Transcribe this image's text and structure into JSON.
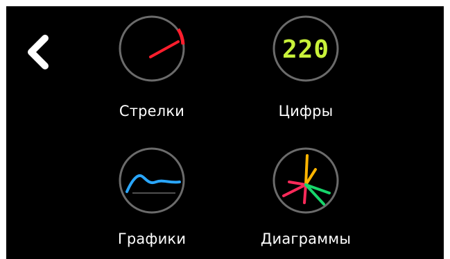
{
  "navigation": {
    "back_icon": "chevron-left-icon"
  },
  "modes": [
    {
      "label": "Стрелки",
      "icon": "needle-gauge-icon"
    },
    {
      "label": "Цифры",
      "icon": "digital-display-icon",
      "display_value": "220"
    },
    {
      "label": "Графики",
      "icon": "line-graph-icon"
    },
    {
      "label": "Диаграммы",
      "icon": "radial-diagram-icon"
    }
  ],
  "colors": {
    "background": "#000000",
    "ring": "#6b6b6b",
    "needle": "#ff1e2d",
    "digits": "#c9f23a",
    "graph_line": "#2aa7ff",
    "diagram_yellow": "#ffb400",
    "diagram_pink": "#ff2a5a",
    "diagram_green": "#17d66b"
  }
}
